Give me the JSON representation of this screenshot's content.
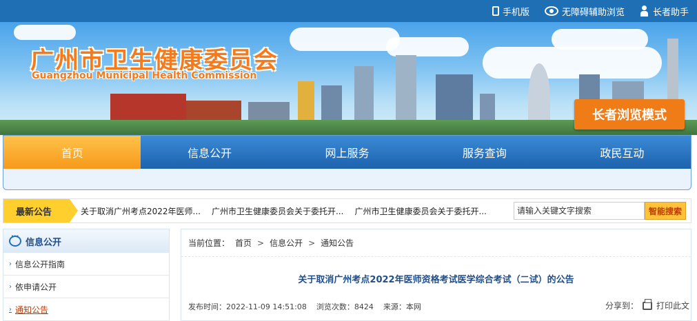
{
  "topbar": {
    "mobile_label": "手机版",
    "accessible_label": "无障碍辅助浏览",
    "elder_label": "长者助手"
  },
  "banner": {
    "title_cn": "广州市卫生健康委员会",
    "title_en": "Guangzhou Municipal Health Commission",
    "elder_mode_label": "长者浏览模式"
  },
  "nav": {
    "items": [
      {
        "label": "首页"
      },
      {
        "label": "信息公开"
      },
      {
        "label": "网上服务"
      },
      {
        "label": "服务查询"
      },
      {
        "label": "政民互动"
      }
    ]
  },
  "notice": {
    "tag": "最新公告",
    "items": [
      "关于取消广州考点2022年医师...",
      "广州市卫生健康委员会关于委托开...",
      "广州市卫生健康委员会关于委托开..."
    ],
    "search_placeholder": "请输入关键文字搜索",
    "search_button": "智能搜索"
  },
  "sidebar": {
    "title": "信息公开",
    "items": [
      {
        "label": "信息公开指南"
      },
      {
        "label": "依申请公开"
      },
      {
        "label": "通知公告"
      }
    ]
  },
  "main": {
    "breadcrumb_prefix": "当前位置：",
    "breadcrumb": [
      "首页",
      "信息公开",
      "通知公告"
    ],
    "breadcrumb_sep": ">",
    "article_title": "关于取消广州考点2022年医师资格考试医学综合考试（二试）的公告",
    "publish_label": "发布时间：",
    "publish_time": "2022-11-09 14:51:08",
    "views_label": "浏览次数：",
    "views": "8424",
    "source_label": "来源：",
    "source": "本网",
    "share_label": "分享到：",
    "print_label": "打印此文"
  }
}
